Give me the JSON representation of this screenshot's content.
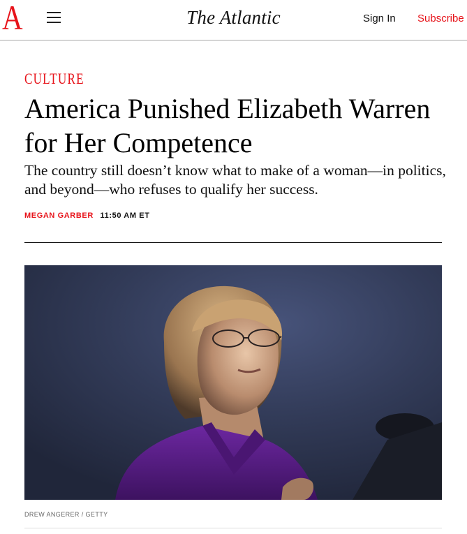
{
  "header": {
    "logo_letter": "A",
    "wordmark": "The Atlantic",
    "sign_in_label": "Sign In",
    "subscribe_label": "Subscribe"
  },
  "article": {
    "section": "CULTURE",
    "headline": "America Punished Elizabeth Warren for Her Competence",
    "dek": "The country still doesn’t know what to make of a woman—in politics, and beyond—who refuses to qualify her success.",
    "author": "MEGAN GARBER",
    "published_time": "11:50 AM ET",
    "photo_credit": "DREW ANGERER / GETTY"
  },
  "colors": {
    "brand_red": "#e7131a",
    "text": "#000000",
    "rule": "#111111",
    "photo_background": "#2c3450",
    "jacket": "#5b1e86"
  },
  "icons": {
    "menu": "hamburger-menu-icon"
  }
}
